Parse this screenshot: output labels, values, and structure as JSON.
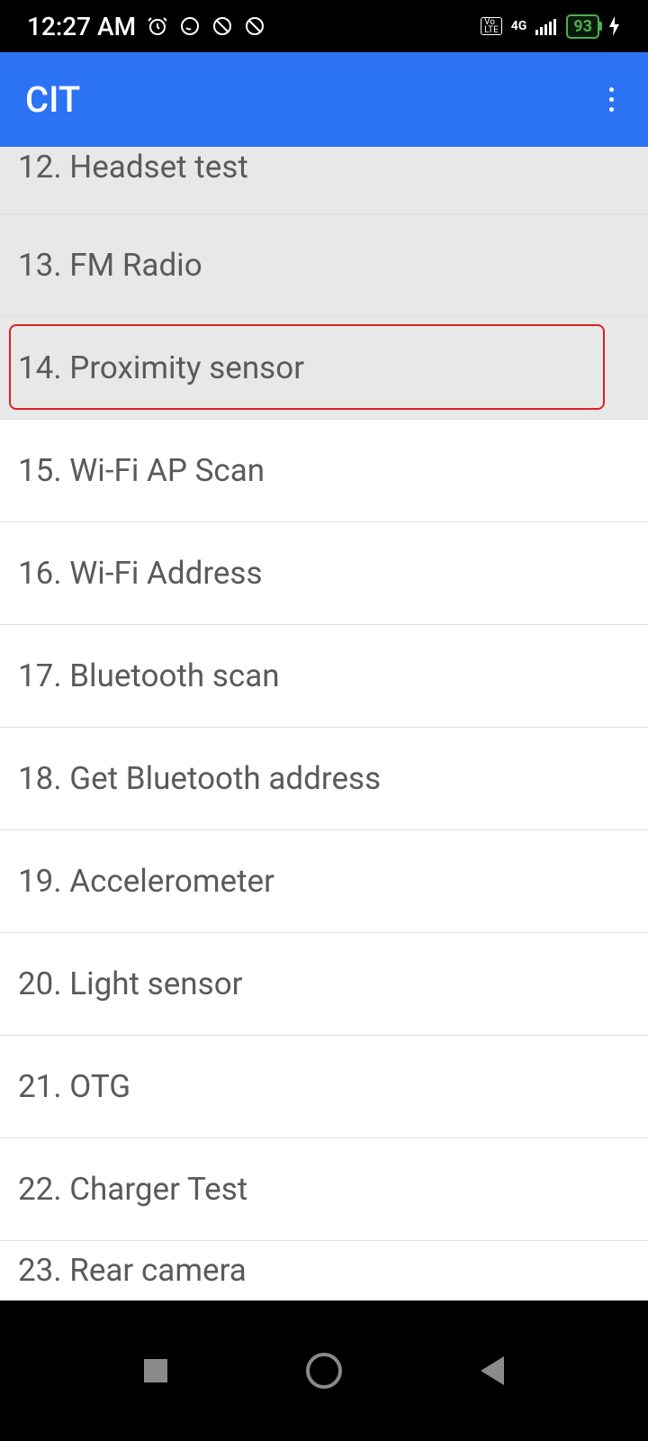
{
  "status": {
    "time": "12:27 AM",
    "battery_percent": "93",
    "network_type": "4G",
    "volte": "Vo\nLTE"
  },
  "header": {
    "title": "CIT"
  },
  "list": {
    "items": [
      {
        "label": "12. Headset test"
      },
      {
        "label": "13. FM Radio"
      },
      {
        "label": "14. Proximity sensor"
      },
      {
        "label": "15. Wi-Fi AP Scan"
      },
      {
        "label": "16. Wi-Fi Address"
      },
      {
        "label": "17. Bluetooth scan"
      },
      {
        "label": "18. Get Bluetooth address"
      },
      {
        "label": "19. Accelerometer"
      },
      {
        "label": "20. Light sensor"
      },
      {
        "label": "21. OTG"
      },
      {
        "label": "22. Charger Test"
      },
      {
        "label": "23. Rear camera"
      }
    ],
    "highlighted_index": 2
  }
}
